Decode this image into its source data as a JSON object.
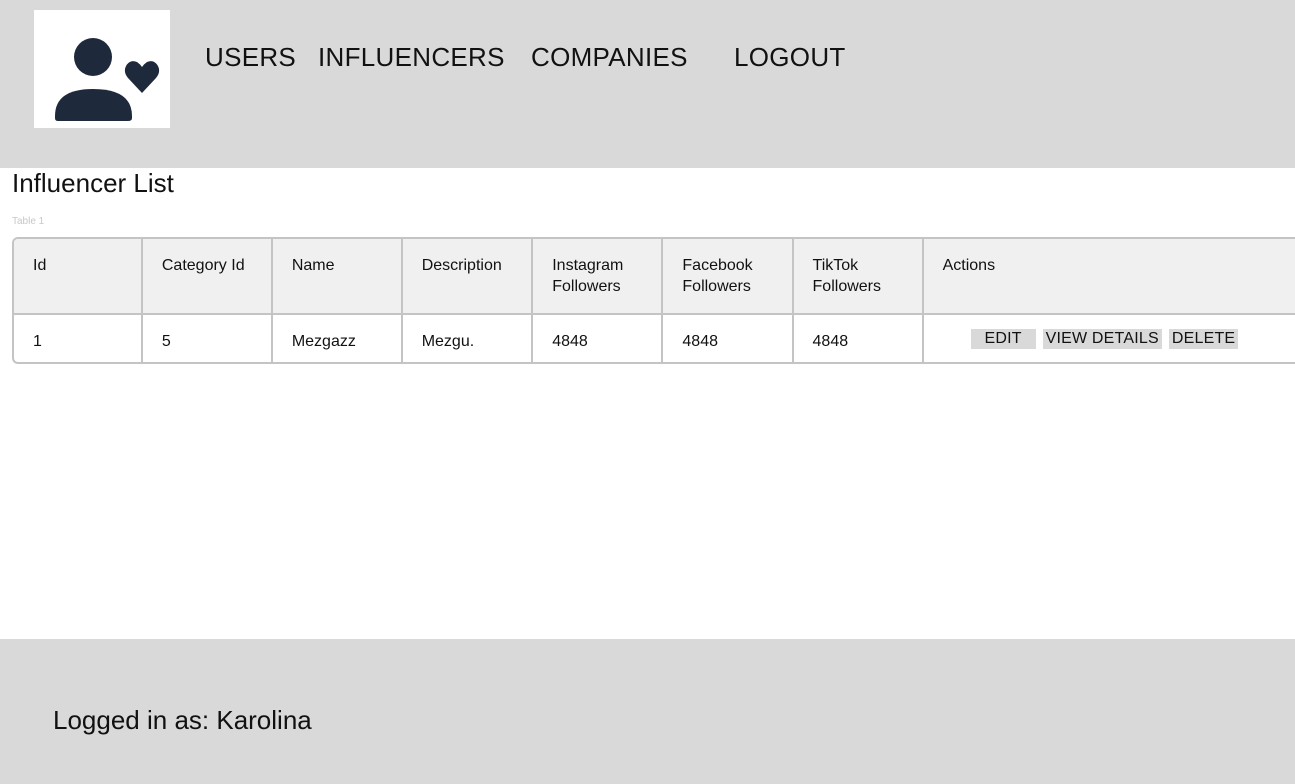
{
  "header": {
    "nav": [
      "USERS",
      "INFLUENCERS",
      "COMPANIES",
      "LOGOUT"
    ],
    "logo_icon": "user-heart-icon"
  },
  "main": {
    "title": "Influencer List",
    "table_caption": "Table 1",
    "table": {
      "columns": [
        "Id",
        "Category Id",
        "Name",
        "Description",
        "Instagram\nFollowers",
        "Facebook\nFollowers",
        "TikTok\nFollowers",
        "Actions"
      ],
      "rows": [
        {
          "cells": [
            "1",
            "5",
            "Mezgazz",
            "Mezgu.",
            "4848",
            "4848",
            "4848"
          ],
          "actions": [
            "EDIT",
            "VIEW DETAILS",
            "DELETE"
          ]
        }
      ]
    }
  },
  "footer": {
    "logged_in_text": "Logged in as: Karolina"
  },
  "colors": {
    "header_bg": "#d9d9d9",
    "icon": "#1e2a3b",
    "table_header_bg": "#f0f0f0",
    "border": "#c4c4c4"
  }
}
